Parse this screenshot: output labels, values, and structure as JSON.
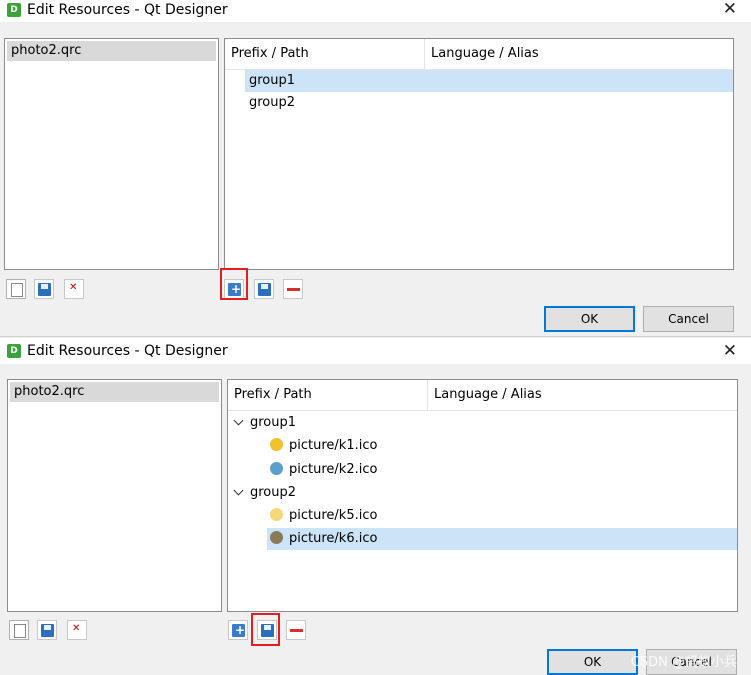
{
  "dialog_top": {
    "title": "Edit Resources - Qt Designer",
    "app_icon": "D",
    "close": "✕",
    "files": [
      "photo2.qrc"
    ],
    "columns": [
      "Prefix / Path",
      "Language / Alias"
    ],
    "tree": [
      "group1",
      "group2"
    ],
    "ok": "OK",
    "cancel": "Cancel"
  },
  "dialog_bottom": {
    "title": "Edit Resources - Qt Designer",
    "app_icon": "D",
    "close": "✕",
    "files": [
      "photo2.qrc"
    ],
    "columns": [
      "Prefix / Path",
      "Language / Alias"
    ],
    "groups": [
      {
        "name": "group1",
        "files": [
          "picture/k1.ico",
          "picture/k2.ico"
        ]
      },
      {
        "name": "group2",
        "files": [
          "picture/k5.ico",
          "picture/k6.ico"
        ]
      }
    ],
    "ok": "OK",
    "cancel": "Cancel"
  },
  "watermark": "CSDN @蚂蚁小兵",
  "icon_colors": {
    "k1": "#f2c12e",
    "k2": "#5aa0c8",
    "k5": "#f5d77a",
    "k6": "#8a7a5a"
  }
}
